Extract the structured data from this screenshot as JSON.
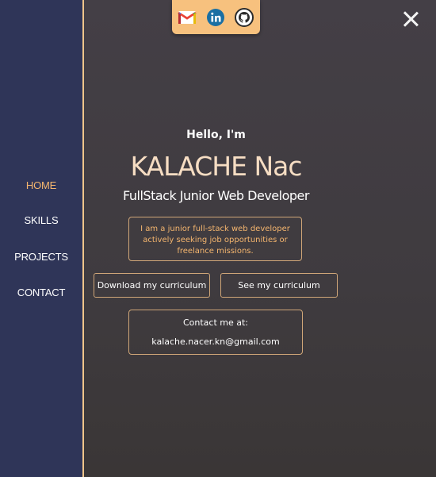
{
  "nav": {
    "items": [
      {
        "label": "HOME",
        "active": true
      },
      {
        "label": "SKILLS",
        "active": false
      },
      {
        "label": "PROJECTS",
        "active": false
      },
      {
        "label": "CONTACT",
        "active": false
      }
    ]
  },
  "social": {
    "icons": [
      "gmail-icon",
      "linkedin-icon",
      "github-icon"
    ]
  },
  "hero": {
    "greeting": "Hello, I'm",
    "name": "KALACHE Nac",
    "subtitle": "FullStack Junior Web Developer",
    "bio": "I am a junior full-stack web developer actively seeking job opportunities or freelance missions."
  },
  "actions": {
    "download_label": "Download my curriculum",
    "see_label": "See my curriculum"
  },
  "contact": {
    "label": "Contact me at:",
    "email": "kalache.nacer.kn@gmail.com"
  },
  "colors": {
    "sidebar_bg": "#2f3558",
    "accent": "#f5b66e",
    "tray_bg": "#f7c17e",
    "main_bg": "#443f46"
  }
}
